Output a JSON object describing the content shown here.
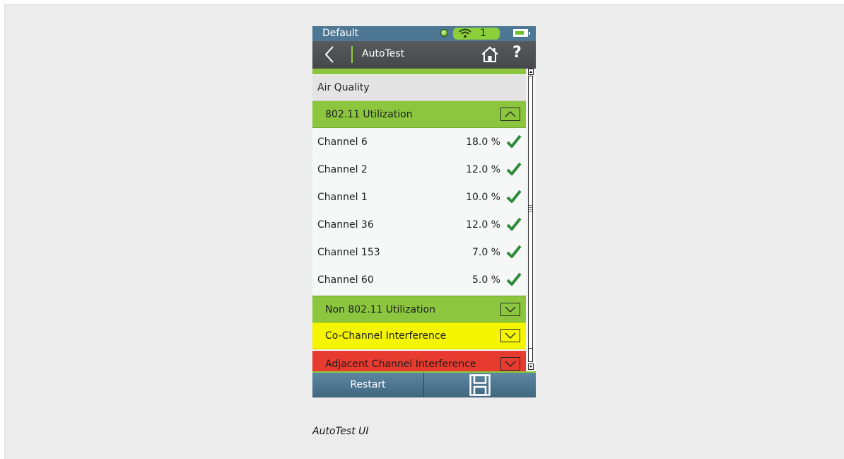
{
  "status_bar": {
    "profile": "Default",
    "wifi_count": "1"
  },
  "nav": {
    "title": "AutoTest"
  },
  "section": {
    "title": "Air Quality"
  },
  "groups": {
    "utilization": {
      "label": "802.11 Utilization",
      "color": "#8cc63f",
      "expanded": true
    },
    "non_utilization": {
      "label": "Non 802.11 Utilization",
      "color": "#8cc63f",
      "expanded": false
    },
    "co_channel": {
      "label": "Co-Channel Interference",
      "color": "#f5f500",
      "expanded": false
    },
    "adjacent": {
      "label": "Adjacent Channel Interference",
      "color": "#e63b2e",
      "expanded": false
    }
  },
  "channels": [
    {
      "name": "Channel 6",
      "value": "18.0 %",
      "status": "pass"
    },
    {
      "name": "Channel 2",
      "value": "12.0 %",
      "status": "pass"
    },
    {
      "name": "Channel 1",
      "value": "10.0 %",
      "status": "pass"
    },
    {
      "name": "Channel 36",
      "value": "12.0 %",
      "status": "pass"
    },
    {
      "name": "Channel 153",
      "value": "7.0 %",
      "status": "pass"
    },
    {
      "name": "Channel 60",
      "value": "5.0 %",
      "status": "pass"
    }
  ],
  "bottom_bar": {
    "restart_label": "Restart",
    "save_icon": "floppy-disk-icon"
  },
  "caption": "AutoTest UI",
  "colors": {
    "header_blue": "#4d7793",
    "accent_green": "#8cc63f",
    "check_green": "#2e8b3a"
  }
}
